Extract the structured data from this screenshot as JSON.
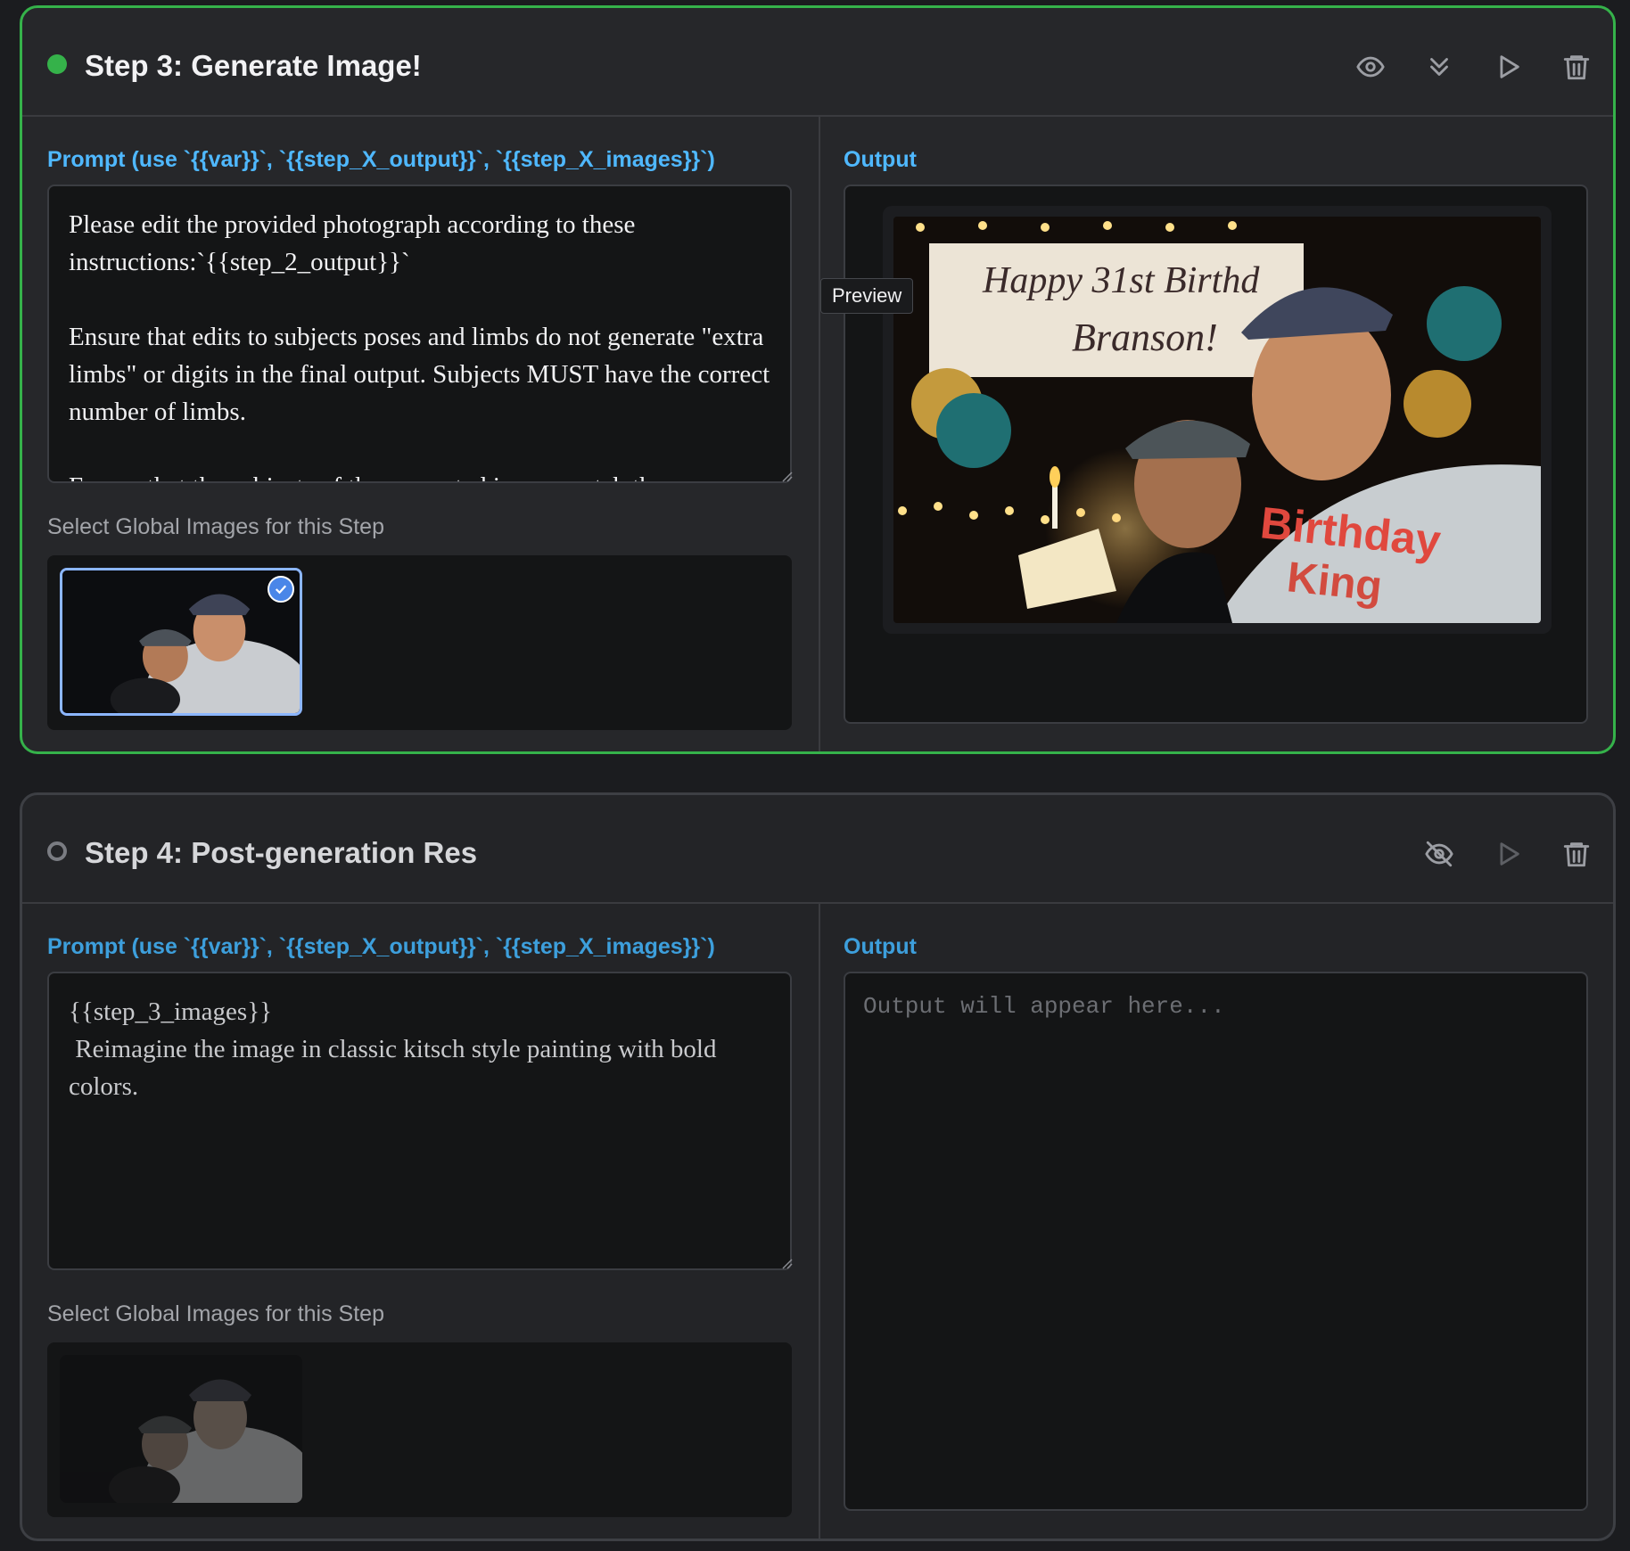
{
  "steps": [
    {
      "title": "Step 3: Generate Image!",
      "prompt_label": "Prompt (use `{{var}}`, `{{step_X_output}}`, `{{step_X_images}}`)",
      "prompt_text": "Please edit the provided photograph according to these instructions:`{{step_2_output}}`\n\nEnsure that edits to subjects poses and limbs do not generate \"extra limbs\" or digits in the final output. Subjects MUST have the correct number of limbs.\n\nEnsure that the subjects of the generated image match the",
      "images_label": "Select Global Images for this Step",
      "output_label": "Output",
      "preview_tooltip": "Preview",
      "output_banner_line1": "Happy 31st Birthd",
      "output_banner_line2": "Branson!",
      "output_shirt_line1": "Birthday",
      "output_shirt_line2": "King"
    },
    {
      "title": "Step 4: Post-generation Res",
      "prompt_label": "Prompt (use `{{var}}`, `{{step_X_output}}`, `{{step_X_images}}`)",
      "prompt_text": "{{step_3_images}}\n Reimagine the image in classic kitsch style painting with bold colors.",
      "images_label": "Select Global Images for this Step",
      "output_label": "Output",
      "output_placeholder": "Output will appear here..."
    }
  ],
  "icons": {
    "step3": [
      "eye-icon",
      "chevrons-down-icon",
      "play-icon",
      "trash-icon"
    ],
    "step4": [
      "eye-off-icon",
      "play-icon",
      "trash-icon"
    ]
  },
  "colors": {
    "active_border": "#35b24a",
    "label_blue": "#4fb8ff",
    "selected_thumb": "#8cb6ff"
  }
}
